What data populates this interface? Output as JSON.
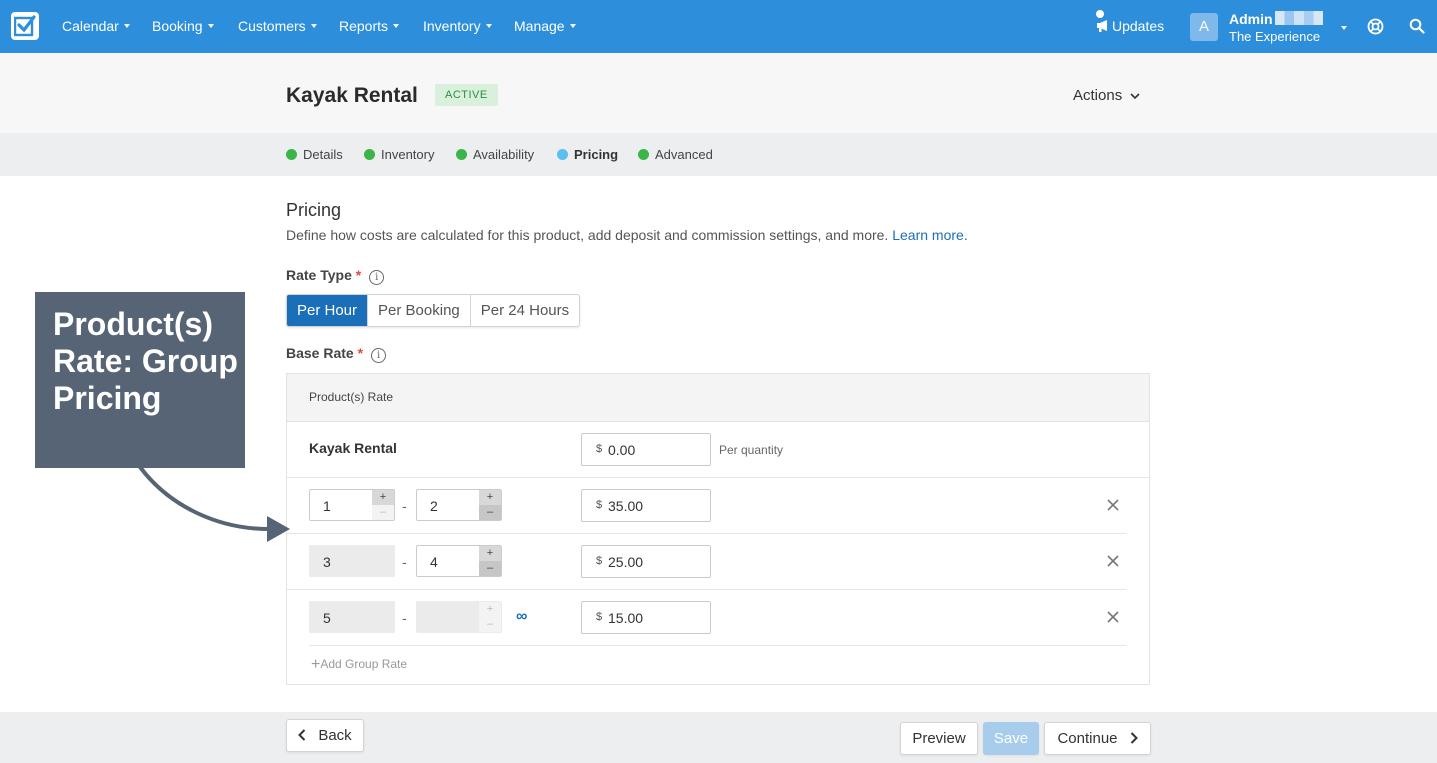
{
  "nav": {
    "items": [
      "Calendar",
      "Booking",
      "Customers",
      "Reports",
      "Inventory",
      "Manage"
    ],
    "updates": "Updates",
    "account_name": "Admin",
    "account_sub": "The Experience",
    "avatar_letter": "A"
  },
  "header": {
    "title": "Kayak Rental",
    "status": "ACTIVE",
    "actions": "Actions"
  },
  "steps": [
    {
      "label": "Details",
      "color": "#3bb54a"
    },
    {
      "label": "Inventory",
      "color": "#3bb54a"
    },
    {
      "label": "Availability",
      "color": "#3bb54a"
    },
    {
      "label": "Pricing",
      "color": "#5bc0f0"
    },
    {
      "label": "Advanced",
      "color": "#3bb54a"
    }
  ],
  "pricing": {
    "title": "Pricing",
    "description": "Define how costs are calculated for this product, add deposit and commission settings, and more.",
    "learn_more": "Learn more",
    "rate_type_label": "Rate Type",
    "rate_types": [
      "Per Hour",
      "Per Booking",
      "Per 24 Hours"
    ],
    "selected_rate_type": "Per Hour",
    "base_rate_label": "Base Rate",
    "panel_header": "Product(s) Rate",
    "product_name": "Kayak Rental",
    "base_currency": "$",
    "base_amount": "0.00",
    "per_quantity": "Per quantity",
    "group_rates": [
      {
        "from": "1",
        "to": "2",
        "amount": "35.00"
      },
      {
        "from": "3",
        "to": "4",
        "amount": "25.00"
      },
      {
        "from": "5",
        "to": "",
        "amount": "15.00",
        "unbounded": "∞"
      }
    ],
    "add_group_rate": "Add Group Rate"
  },
  "footer": {
    "back": "Back",
    "preview": "Preview",
    "save": "Save",
    "continue": "Continue"
  },
  "annotation": {
    "text": "Product(s) Rate: Group Pricing"
  },
  "colors": {
    "nav_bg": "#2d8fdc",
    "primary": "#1a6fb8",
    "callout_bg": "#566475"
  }
}
